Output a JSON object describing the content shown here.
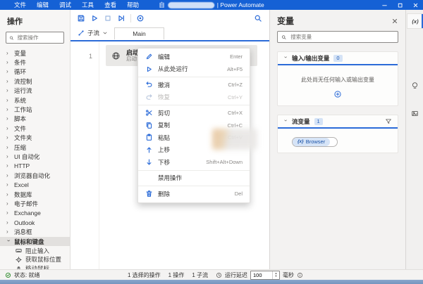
{
  "colors": {
    "titlebar": "#1561d5",
    "accent": "#2b6bd8",
    "status_ok": "#107c10"
  },
  "titlebar": {
    "menu": [
      "文件",
      "编辑",
      "调试",
      "工具",
      "查看",
      "帮助"
    ],
    "title_prefix": "自",
    "title_suffix": "| Power Automate"
  },
  "actions_panel": {
    "title": "操作",
    "search_placeholder": "搜索操作",
    "groups": [
      "变量",
      "条件",
      "循环",
      "流控制",
      "运行流",
      "系统",
      "工作站",
      "脚本",
      "文件",
      "文件夹",
      "压缩",
      "UI 自动化",
      "HTTP",
      "浏览器自动化",
      "Excel",
      "数据库",
      "电子邮件",
      "Exchange",
      "Outlook",
      "消息框"
    ],
    "expanded_group": "鼠标和键盘",
    "sub_items": [
      "阻止输入",
      "获取鼠标位置",
      "移动鼠标"
    ]
  },
  "canvas": {
    "subflows_label": "子流",
    "active_tab": "Main",
    "row_number": "1",
    "action_title": "启动",
    "action_subtitle": "启动"
  },
  "context_menu": {
    "items": [
      {
        "label": "编辑",
        "shortcut": "Enter"
      },
      {
        "label": "从此处运行",
        "shortcut": "Alt+F5"
      },
      {
        "label": "撤消",
        "shortcut": "Ctrl+Z"
      },
      {
        "label": "恢复",
        "shortcut": "Ctrl+Y"
      },
      {
        "label": "剪切",
        "shortcut": "Ctrl+X"
      },
      {
        "label": "复制",
        "shortcut": "Ctrl+C"
      },
      {
        "label": "粘贴",
        "shortcut": "Ctrl+V"
      },
      {
        "label": "上移",
        "shortcut": ""
      },
      {
        "label": "下移",
        "shortcut": "Shift+Alt+Down"
      },
      {
        "label": "禁用操作",
        "shortcut": ""
      },
      {
        "label": "删除",
        "shortcut": "Del"
      }
    ]
  },
  "variables_panel": {
    "title": "变量",
    "search_placeholder": "搜索变量",
    "io_section": {
      "label": "输入/输出变量",
      "badge": "0",
      "empty_text": "此处尚无任何输入或输出变量"
    },
    "flow_section": {
      "label": "流变量",
      "badge": "1",
      "variable_type": "{x}",
      "variable_name": "Browser"
    }
  },
  "right_rail": {
    "variables_label": "(x)"
  },
  "status_bar": {
    "status": "状态: 就绪",
    "selected_actions": "1 选择的操作",
    "actions_count": "1 操作",
    "subflows_count": "1 子流",
    "run_delay_label": "运行延迟",
    "run_delay_value": "100",
    "unit": "毫秒"
  }
}
